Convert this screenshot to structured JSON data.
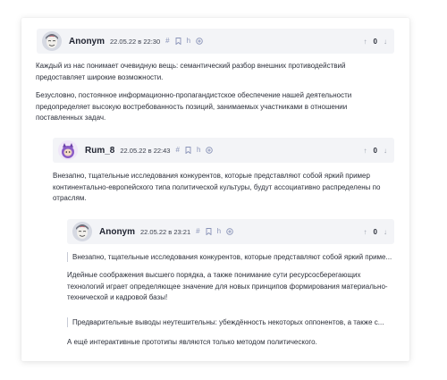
{
  "comments": [
    {
      "author": "Anonym",
      "date": "22.05.22 в 22:30",
      "votes": "0",
      "avatar_icon": "anonymous-face-avatar",
      "paragraphs": [
        "Каждый из нас понимает очевидную вещь: семантический разбор внешних противодействий предоставляет широкие возможности.",
        "Безусловно, постоянное информационно-пропагандистское обеспечение нашей деятельности предопределяет высокую востребованность позиций, занимаемых участниками в отношении поставленных задач."
      ]
    },
    {
      "author": "Rum_8",
      "date": "22.05.22 в 22:43",
      "votes": "0",
      "avatar_icon": "purple-character-avatar",
      "paragraphs": [
        "Внезапно, тщательные исследования конкурентов, которые представляют собой яркий пример континентально-европейского типа политической культуры, будут ассоциативно распределены по отраслям."
      ]
    },
    {
      "author": "Anonym",
      "date": "22.05.22 в 23:21",
      "votes": "0",
      "avatar_icon": "anonymous-face-avatar",
      "quote1": "Внезапно, тщательные исследования конкурентов, которые представляют собой яркий приме...",
      "paragraph1": "Идейные соображения высшего порядка, а также понимание сути ресурсосберегающих технологий играет определяющее значение для новых принципов формирования материально-технической и кадровой базы!",
      "quote2": "Предварительные выводы неутешительны: убеждённость некоторых оппонентов, а также с...",
      "paragraph2": "А ещё интерактивные прототипы являются только методом политического."
    }
  ],
  "icons": {
    "hash": "#",
    "bookmark": "⊓",
    "reply": "h",
    "add": "⊕",
    "up": "↑",
    "down": "↓"
  },
  "colors": {
    "header_bg": "#f3f4f7",
    "icon": "#8a94b8"
  }
}
